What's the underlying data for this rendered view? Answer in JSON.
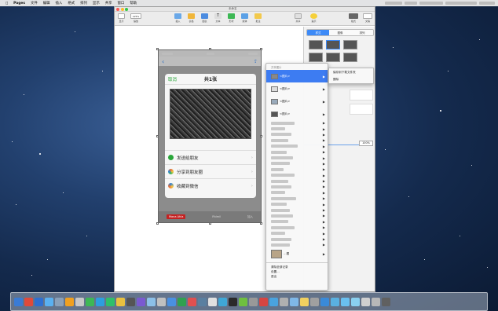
{
  "menubar": {
    "app": "Pages",
    "items": [
      "文件",
      "编辑",
      "插入",
      "格式",
      "排列",
      "显示",
      "共享",
      "窗口",
      "帮助"
    ]
  },
  "window": {
    "title": "未命名",
    "toolbar": {
      "view": "显示",
      "zoom": "125%",
      "zoom_label": "缩放",
      "insert": "插入",
      "table": "表格",
      "chart": "图表",
      "text": "文本",
      "shape": "形状",
      "media": "媒体",
      "comment": "批注",
      "share": "共享",
      "tips": "提示",
      "format": "格式",
      "document": "文稿"
    },
    "sidebar": {
      "tabs": [
        "样式",
        "图像",
        "排列"
      ],
      "opacity": "100%"
    }
  },
  "phone": {
    "cancel": "取消",
    "count": "共1张",
    "options": [
      {
        "label": "发送给朋友",
        "color": "#2aa63a"
      },
      {
        "label": "分享到朋友圈",
        "color": "#e8703a"
      },
      {
        "label": "收藏到微信",
        "color": "#2f86d8"
      }
    ],
    "tab_left": "Mana Ahla",
    "tab_mid": "Rhimil",
    "tab_right": "加入"
  },
  "context_menu": {
    "title": "共享图片",
    "rows": [
      {
        "label": "<图片>",
        "highlighted": true,
        "thumb": true
      },
      {
        "label": "<图片>",
        "highlighted": false,
        "thumb": true
      },
      {
        "label": "<图片>",
        "highlighted": false,
        "thumb": true
      },
      {
        "label": "<图片>",
        "highlighted": false,
        "thumb": true
      }
    ],
    "footer": [
      "清除全部记录",
      "设置…",
      "退出"
    ],
    "last_label": "…图"
  },
  "submenu": {
    "items": [
      "保存到下载文件夹",
      "删除"
    ]
  },
  "colors": {
    "accent": "#3d7cf2",
    "wechat_green": "#2aa63a"
  }
}
